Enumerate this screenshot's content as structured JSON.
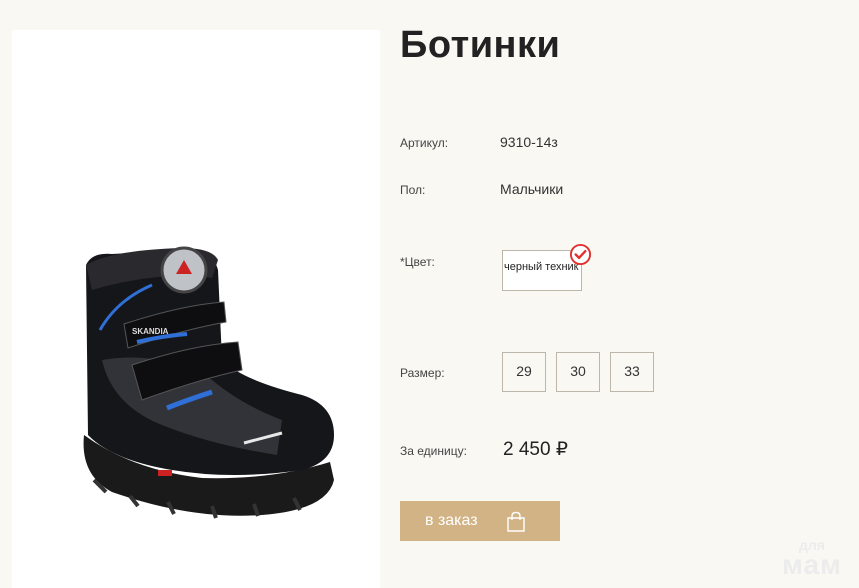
{
  "product": {
    "title": "Ботинки",
    "image_brand": "SKANDIA",
    "article_label": "Артикул:",
    "article_value": "9310-14з",
    "gender_label": "Пол:",
    "gender_value": "Мальчики",
    "color_label": "*Цвет:",
    "color_option": "черный техник",
    "size_label": "Размер:",
    "sizes": [
      "29",
      "30",
      "33"
    ],
    "price_label": "За единицу:",
    "price_value": "2 450 ₽"
  },
  "order": {
    "button_label": "в заказ",
    "icon": "shopping-bag-icon"
  },
  "watermark": {
    "line1": "для",
    "line2": "мам"
  },
  "colors": {
    "accent": "#d2b386",
    "background": "#faf8f3",
    "check": "#e03030",
    "stripe": "#2f6fd6"
  }
}
